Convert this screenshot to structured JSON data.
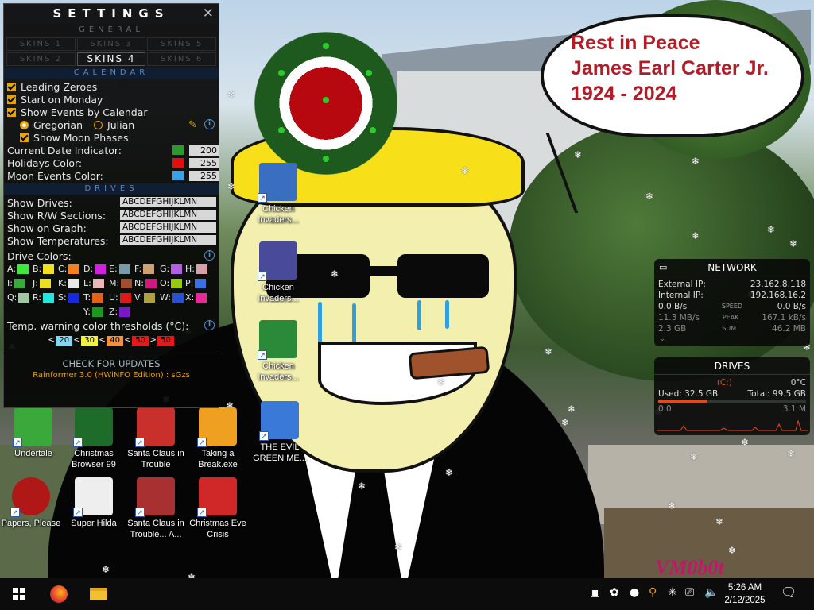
{
  "speech_bubble": {
    "lines": [
      "Rest in Peace",
      "James Earl Carter Jr.",
      "1924 - 2024"
    ]
  },
  "desktop_icons": [
    {
      "label": "Undertale",
      "color": "#3aa83a"
    },
    {
      "label": "Christmas Browser 99",
      "color": "#1f6b2a"
    },
    {
      "label": "Santa Claus in Trouble",
      "color": "#c9302c"
    },
    {
      "label": "Taking a Break.exe",
      "color": "#f0a020"
    },
    {
      "label": "THE EVIL GREEN ME...",
      "color": "#3b79d8"
    },
    {
      "label": "Papers, Please",
      "color": "#b01818"
    },
    {
      "label": "Super Hilda",
      "color": "#eeeeee"
    },
    {
      "label": "Santa Claus in Trouble... A...",
      "color": "#a83030"
    },
    {
      "label": "Christmas Eve Crisis",
      "color": "#d02828"
    },
    {
      "label": "Chicken Invaders...",
      "color": "#3a6ec0"
    },
    {
      "label": "Chicken Invaders...",
      "color": "#4a4a9a"
    },
    {
      "label": "Chicken Invaders...",
      "color": "#2a8a3a"
    }
  ],
  "settings": {
    "title": "SETTINGS",
    "close_glyph": "✕",
    "general_header": "GENERAL",
    "tabs": [
      "SKINS 1",
      "SKINS 3",
      "SKINS 5",
      "SKINS 2",
      "SKINS 4",
      "SKINS 6"
    ],
    "active_tab": "SKINS 4",
    "calendar_header": "CALENDAR",
    "calendar": {
      "leading_zeroes": "Leading Zeroes",
      "start_on_monday": "Start on Monday",
      "show_events": "Show Events by Calendar",
      "gregorian": "Gregorian",
      "julian": "Julian",
      "show_moon_phases": "Show Moon Phases",
      "current_date_label": "Current Date Indicator:",
      "current_date_value": "200",
      "current_date_color": "#2a9a2a",
      "holidays_label": "Holidays Color:",
      "holidays_value": "255",
      "holidays_color": "#e01010",
      "moon_label": "Moon Events Color:",
      "moon_value": "255",
      "moon_color": "#3aa0e8"
    },
    "drives_header": "DRIVES",
    "drives": {
      "show_drives": "Show Drives:",
      "show_rw": "Show R/W Sections:",
      "show_graph": "Show on Graph:",
      "show_temps": "Show Temperatures:",
      "letters_value": "ABCDEFGHIJKLMN",
      "drive_colors_label": "Drive Colors:",
      "drive_colors": [
        {
          "k": "A:",
          "c": "#3de83d"
        },
        {
          "k": "B:",
          "c": "#f0e020"
        },
        {
          "k": "C:",
          "c": "#f08020"
        },
        {
          "k": "D:",
          "c": "#d020e0"
        },
        {
          "k": "E:",
          "c": "#7a9aa8"
        },
        {
          "k": "F:",
          "c": "#cfa070"
        },
        {
          "k": "G:",
          "c": "#b060e0"
        },
        {
          "k": "H:",
          "c": "#d8a0a8"
        },
        {
          "k": "I:",
          "c": "#3aa83a"
        },
        {
          "k": "J:",
          "c": "#e8e020"
        },
        {
          "k": "K:",
          "c": "#e8e8e8"
        },
        {
          "k": "L:",
          "c": "#e8b8b8"
        },
        {
          "k": "M:",
          "c": "#a05030"
        },
        {
          "k": "N:",
          "c": "#d01880"
        },
        {
          "k": "O:",
          "c": "#98c810"
        },
        {
          "k": "P:",
          "c": "#3a70e0"
        },
        {
          "k": "Q:",
          "c": "#a0c8a0"
        },
        {
          "k": "R:",
          "c": "#20e8e0"
        },
        {
          "k": "S:",
          "c": "#1828e0"
        },
        {
          "k": "T:",
          "c": "#e86018"
        },
        {
          "k": "U:",
          "c": "#e01818"
        },
        {
          "k": "V:",
          "c": "#b0a040"
        },
        {
          "k": "W:",
          "c": "#2850d0"
        },
        {
          "k": "X:",
          "c": "#e82898"
        },
        {
          "k": "Y:",
          "c": "#1a9a1a"
        },
        {
          "k": "Z:",
          "c": "#7a18c8"
        }
      ],
      "temp_label": "Temp. warning color thresholds (°C):",
      "thresholds": [
        {
          "v": "20",
          "c": "#7fd8f0"
        },
        {
          "v": "30",
          "c": "#f0f040"
        },
        {
          "v": "40",
          "c": "#f09040"
        },
        {
          "v": "50",
          "c": "#e81818"
        },
        {
          "v": "50",
          "c": "#e81818"
        }
      ],
      "threshold_ops": [
        "<",
        "<",
        "<",
        "<",
        ">"
      ]
    },
    "check_updates": "CHECK FOR UPDATES",
    "footer": "Rainformer 3.0 (HWiNFO Edition) : sGzs"
  },
  "network": {
    "title": "NETWORK",
    "external_label": "External IP:",
    "external_value": "23.162.8.118",
    "internal_label": "Internal IP:",
    "internal_value": "192.168.16.2",
    "down_speed": "0.0 B/s",
    "speed_label": "SPEED",
    "up_speed": "0.0 B/s",
    "peak_down": "11.3 MB/s",
    "peak_label": "PEAK",
    "peak_up": "167.1 kB/s",
    "sum_down": "2.3 GB",
    "sum_label": "SUM",
    "sum_up": "46.2 MB"
  },
  "drives_widget": {
    "title": "DRIVES",
    "drive": "(C:)",
    "temp": "0°C",
    "used": "Used: 32.5 GB",
    "total": "Total: 99.5 GB",
    "read": "0.0",
    "write": "3.1 M",
    "usage_fraction": 0.33
  },
  "watermark": "VM0b0t",
  "taskbar": {
    "time": "5:26 AM",
    "date": "2/12/2025"
  }
}
